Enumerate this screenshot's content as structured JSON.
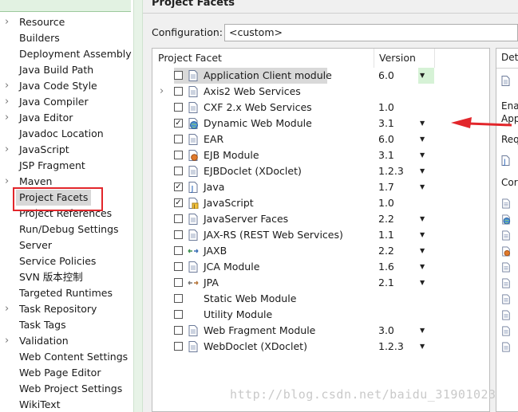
{
  "nav": {
    "items": [
      {
        "label": "Resource",
        "expandable": true
      },
      {
        "label": "Builders"
      },
      {
        "label": "Deployment Assembly"
      },
      {
        "label": "Java Build Path"
      },
      {
        "label": "Java Code Style",
        "expandable": true
      },
      {
        "label": "Java Compiler",
        "expandable": true
      },
      {
        "label": "Java Editor",
        "expandable": true
      },
      {
        "label": "Javadoc Location"
      },
      {
        "label": "JavaScript",
        "expandable": true
      },
      {
        "label": "JSP Fragment"
      },
      {
        "label": "Maven",
        "expandable": true
      },
      {
        "label": "Project Facets",
        "selected": true
      },
      {
        "label": "Project References"
      },
      {
        "label": "Run/Debug Settings"
      },
      {
        "label": "Server"
      },
      {
        "label": "Service Policies"
      },
      {
        "label": "SVN 版本控制"
      },
      {
        "label": "Targeted Runtimes"
      },
      {
        "label": "Task Repository",
        "expandable": true
      },
      {
        "label": "Task Tags"
      },
      {
        "label": "Validation",
        "expandable": true
      },
      {
        "label": "Web Content Settings"
      },
      {
        "label": "Web Page Editor"
      },
      {
        "label": "Web Project Settings"
      },
      {
        "label": "WikiText"
      }
    ]
  },
  "page": {
    "title": "Project Facets",
    "configuration_label": "Configuration:",
    "configuration_value": "<custom>"
  },
  "table": {
    "headers": {
      "facet": "Project Facet",
      "version": "Version"
    },
    "rows": [
      {
        "label": "Application Client module",
        "version": "6.0",
        "checked": false,
        "icon": "document-icon",
        "dropdown": true,
        "selected": true
      },
      {
        "label": "Axis2 Web Services",
        "version": "",
        "checked": false,
        "icon": "document-icon",
        "expandable": true
      },
      {
        "label": "CXF 2.x Web Services",
        "version": "1.0",
        "checked": false,
        "icon": "document-icon"
      },
      {
        "label": "Dynamic Web Module",
        "version": "3.1",
        "checked": true,
        "icon": "globe-icon",
        "dropdown": true
      },
      {
        "label": "EAR",
        "version": "6.0",
        "checked": false,
        "icon": "document-icon",
        "dropdown": true
      },
      {
        "label": "EJB Module",
        "version": "3.1",
        "checked": false,
        "icon": "ejb-icon",
        "dropdown": true
      },
      {
        "label": "EJBDoclet (XDoclet)",
        "version": "1.2.3",
        "checked": false,
        "icon": "document-icon",
        "dropdown": true
      },
      {
        "label": "Java",
        "version": "1.7",
        "checked": true,
        "icon": "java-icon",
        "dropdown": true
      },
      {
        "label": "JavaScript",
        "version": "1.0",
        "checked": true,
        "icon": "javascript-icon"
      },
      {
        "label": "JavaServer Faces",
        "version": "2.2",
        "checked": false,
        "icon": "document-icon",
        "dropdown": true
      },
      {
        "label": "JAX-RS (REST Web Services)",
        "version": "1.1",
        "checked": false,
        "icon": "document-icon",
        "dropdown": true
      },
      {
        "label": "JAXB",
        "version": "2.2",
        "checked": false,
        "icon": "jaxb-icon",
        "dropdown": true
      },
      {
        "label": "JCA Module",
        "version": "1.6",
        "checked": false,
        "icon": "document-icon",
        "dropdown": true
      },
      {
        "label": "JPA",
        "version": "2.1",
        "checked": false,
        "icon": "jpa-icon",
        "dropdown": true
      },
      {
        "label": "Static Web Module",
        "version": "",
        "checked": false,
        "icon": "none"
      },
      {
        "label": "Utility Module",
        "version": "",
        "checked": false,
        "icon": "none"
      },
      {
        "label": "Web Fragment Module",
        "version": "3.0",
        "checked": false,
        "icon": "document-icon",
        "dropdown": true
      },
      {
        "label": "WebDoclet (XDoclet)",
        "version": "1.2.3",
        "checked": false,
        "icon": "document-icon",
        "dropdown": true
      }
    ]
  },
  "details": {
    "tab": "Det",
    "line1": "Ena",
    "line2": "App",
    "line3": "Req",
    "line4": "Cor"
  },
  "watermark": "http://blog.csdn.net/baidu_31901023",
  "colors": {
    "annotation_red": "#e2262b",
    "splitter_green": "#e7f3e7",
    "selection_gray": "#d9d9d9"
  }
}
